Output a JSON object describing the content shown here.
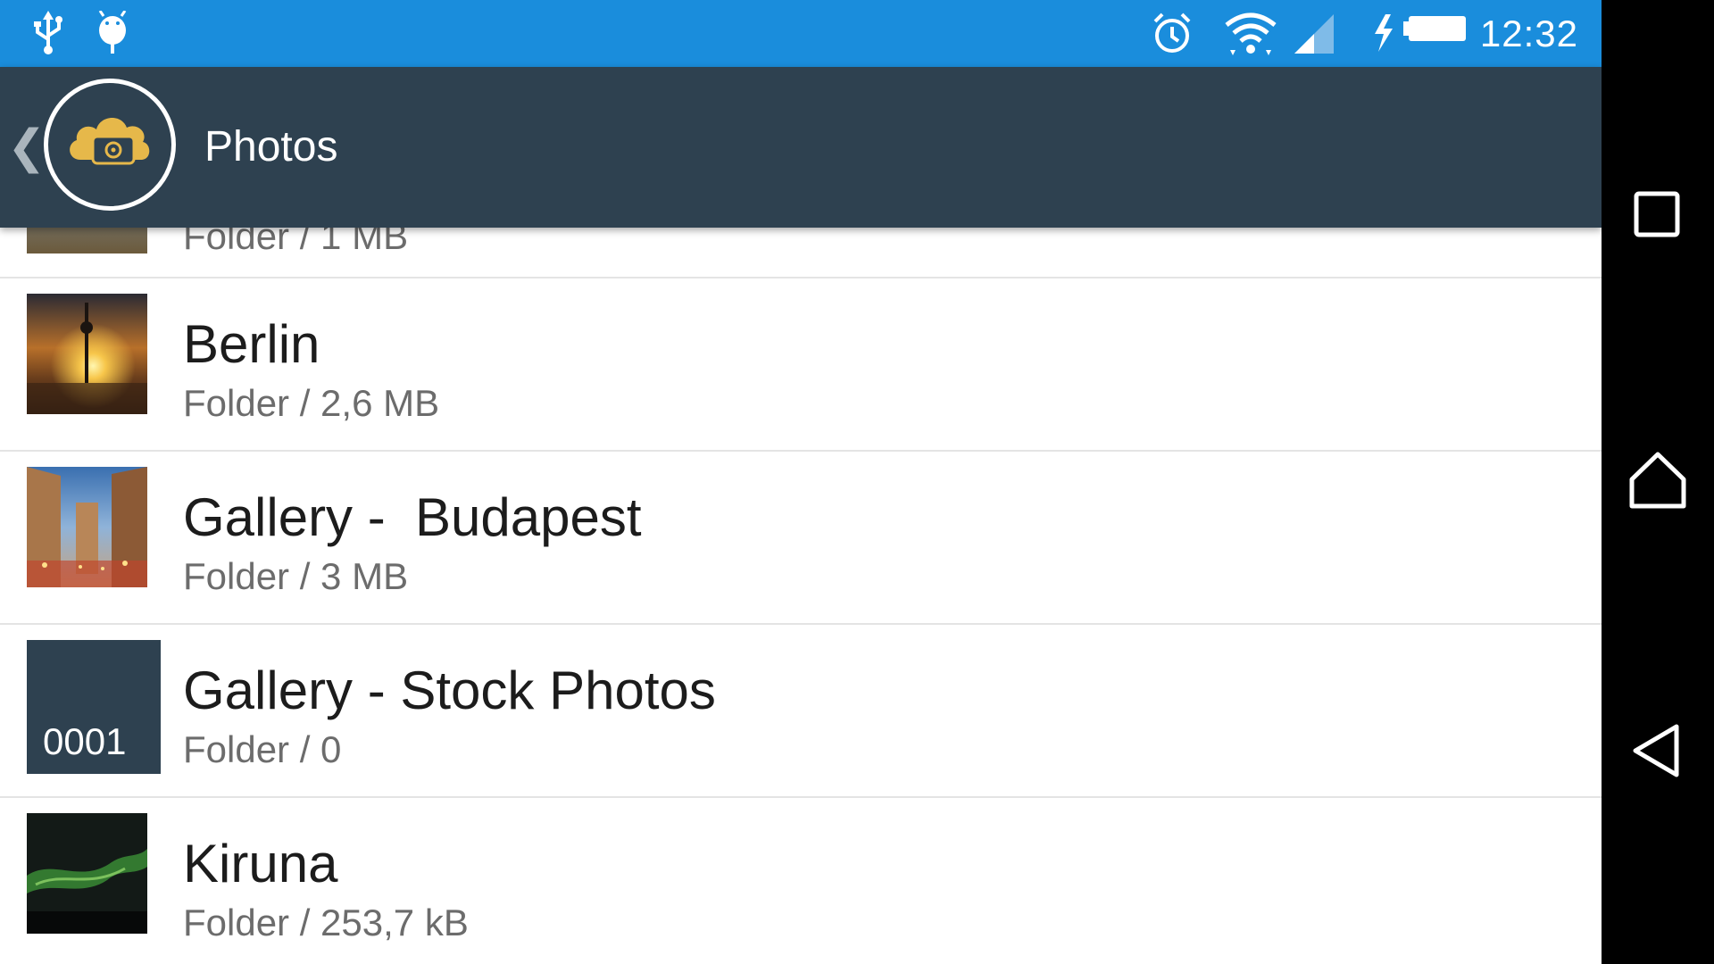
{
  "status_bar": {
    "time": "12:32",
    "icons": [
      "usb-icon",
      "android-debug-icon",
      "alarm-icon",
      "wifi-icon",
      "signal-icon",
      "battery-charging-icon"
    ],
    "background": "#1a8ddc"
  },
  "app_bar": {
    "title": "Photos",
    "logo_icon": "cloud-camera-icon",
    "background": "#2e4150",
    "accent": "#e6b84a"
  },
  "list": {
    "partial_item": {
      "subtitle": "Folder / 1 MB"
    },
    "items": [
      {
        "title": "Berlin",
        "subtitle": "Folder / 2,6 MB",
        "thumbnail": "berlin-photo"
      },
      {
        "title": "Gallery -  Budapest",
        "subtitle": "Folder / 3 MB",
        "thumbnail": "budapest-photo"
      },
      {
        "title": "Gallery - Stock Photos",
        "subtitle": "Folder / 0",
        "thumbnail_badge": "0001"
      },
      {
        "title": "Kiruna",
        "subtitle": "Folder / 253,7 kB",
        "thumbnail": "kiruna-photo"
      }
    ]
  },
  "nav_bar": {
    "buttons": [
      "recent-apps-icon",
      "home-icon",
      "back-icon"
    ]
  }
}
